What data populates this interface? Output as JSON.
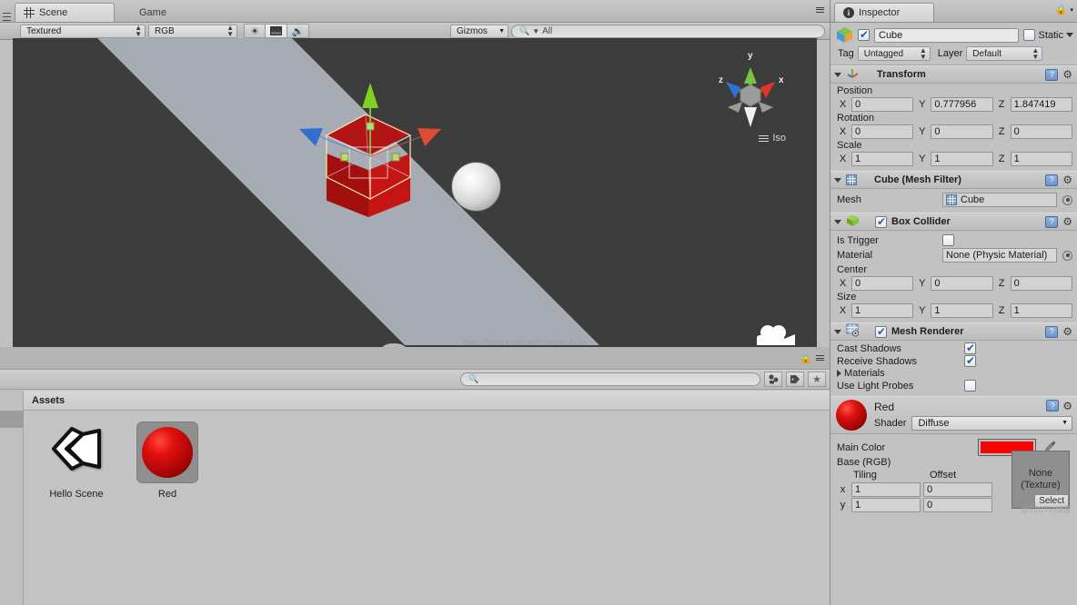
{
  "window": {
    "tabs": [
      {
        "label": "Scene",
        "icon": "hash-grid-icon",
        "active": true
      },
      {
        "label": "Game",
        "icon": "game-pacman-icon",
        "active": false
      }
    ]
  },
  "scene_toolbar": {
    "draw_mode": "Textured",
    "color_mode": "RGB",
    "lighting_icon": "sun-icon",
    "fx_icon": "image-icon",
    "audio_icon": "speaker-icon",
    "gizmos_label": "Gizmos",
    "search_placeholder": "All",
    "search_value": "All",
    "search_icon": "search-icon"
  },
  "scene_view": {
    "axis_gizmo": {
      "x_label": "x",
      "y_label": "y",
      "z_label": "z"
    },
    "projection_label": "Iso",
    "projection_icon": "burger-menu-icon",
    "camera_icon": "camera-icon",
    "watermark": "http://blog.csdn.net/panjunbiao",
    "objects": [
      {
        "name": "Cube",
        "color": "#b31414",
        "selected": true
      },
      {
        "name": "Sphere",
        "color": "#d6d6d6",
        "selected": false
      },
      {
        "name": "Plane",
        "color": "#a7acb4",
        "selected": false
      }
    ],
    "background_color": "#3c3c3c"
  },
  "scene_footer": {
    "lock_icon": "lock-icon",
    "menu_icon": "panel-menu-icon"
  },
  "project": {
    "toolbar": {
      "search_icon": "search-icon",
      "search_value": "",
      "search_placeholder": "",
      "filter_type_icon": "filter-type-icon",
      "filter_label_icon": "filter-label-icon",
      "favorites_icon": "star-icon"
    },
    "header": "Assets",
    "assets": [
      {
        "label": "Hello Scene",
        "icon": "unity-scene-icon"
      },
      {
        "label": "Red",
        "icon": "material-sphere-icon"
      }
    ]
  },
  "inspector": {
    "tab_label": "Inspector",
    "tab_icon": "info-icon",
    "lock_icon": "lock-icon",
    "menu_icon": "panel-menu-icon",
    "object": {
      "icon": "cube-icon",
      "enabled": true,
      "name": "Cube",
      "static_label": "Static",
      "static_checked": false,
      "tag_label": "Tag",
      "tag_value": "Untagged",
      "layer_label": "Layer",
      "layer_value": "Default"
    },
    "components": [
      {
        "title": "Transform",
        "icon": "transform-axis-icon",
        "expanded": true,
        "has_checkbox": false,
        "help_icon": "help-icon",
        "gear_icon": "gear-icon",
        "vectors": [
          {
            "label": "Position",
            "x": "0",
            "y": "0.777956",
            "z": "1.847419"
          },
          {
            "label": "Rotation",
            "x": "0",
            "y": "0",
            "z": "0"
          },
          {
            "label": "Scale",
            "x": "1",
            "y": "1",
            "z": "1"
          }
        ]
      },
      {
        "title": "Cube (Mesh Filter)",
        "icon": "mesh-filter-icon",
        "expanded": true,
        "has_checkbox": false,
        "help_icon": "help-icon",
        "gear_icon": "gear-icon",
        "mesh_label": "Mesh",
        "mesh_value": "Cube",
        "mesh_value_icon": "mesh-icon"
      },
      {
        "title": "Box Collider",
        "icon": "box-collider-icon",
        "expanded": true,
        "has_checkbox": true,
        "checked": true,
        "help_icon": "help-icon",
        "gear_icon": "gear-icon",
        "is_trigger_label": "Is Trigger",
        "is_trigger_checked": false,
        "material_label": "Material",
        "material_value": "None (Physic Material)",
        "vectors": [
          {
            "label": "Center",
            "x": "0",
            "y": "0",
            "z": "0"
          },
          {
            "label": "Size",
            "x": "1",
            "y": "1",
            "z": "1"
          }
        ]
      },
      {
        "title": "Mesh Renderer",
        "icon": "mesh-renderer-icon",
        "expanded": true,
        "has_checkbox": true,
        "checked": true,
        "help_icon": "help-icon",
        "gear_icon": "gear-icon",
        "rows": [
          {
            "label": "Cast Shadows",
            "checked": true,
            "type": "checkbox"
          },
          {
            "label": "Receive Shadows",
            "checked": true,
            "type": "checkbox"
          },
          {
            "label": "Materials",
            "type": "foldout"
          },
          {
            "label": "Use Light Probes",
            "checked": false,
            "type": "checkbox"
          }
        ]
      }
    ],
    "material": {
      "name": "Red",
      "preview_icon": "material-sphere-icon",
      "help_icon": "help-icon",
      "gear_icon": "gear-icon",
      "shader_label": "Shader",
      "shader_value": "Diffuse",
      "main_color_label": "Main Color",
      "main_color_value": "#f50505",
      "eyedropper_icon": "eyedropper-icon",
      "base_rgb_label": "Base (RGB)",
      "tiling_label": "Tiling",
      "offset_label": "Offset",
      "rows": [
        {
          "axis": "x",
          "tiling": "1",
          "offset": "0"
        },
        {
          "axis": "y",
          "tiling": "1",
          "offset": "0"
        }
      ],
      "texture_none_line1": "None",
      "texture_none_line2": "(Texture)",
      "texture_select_label": "Select",
      "watermark": "@51CTO博客"
    }
  }
}
